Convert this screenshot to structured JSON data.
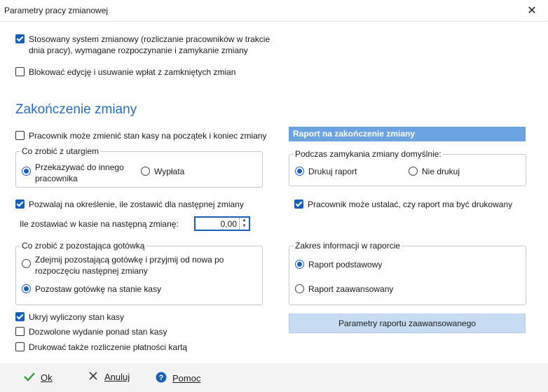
{
  "window": {
    "title": "Parametry pracy zmianowej"
  },
  "top": {
    "shift_system": {
      "label_line1": "Stosowany system zmianowy (rozliczanie pracowników w trakcie",
      "label_line2": "dnia pracy), wymagane rozpoczynanie i zamykanie zmiany",
      "checked": true
    },
    "block_edit": {
      "label": "Blokować edycję i usuwanie wpłat z zamkniętych zmian",
      "checked": false
    }
  },
  "end_shift": {
    "heading": "Zakończenie zmiany",
    "change_cash": {
      "label": "Pracownik może zmienić stan kasy na początek i koniec zmiany",
      "checked": false
    },
    "revenue_group": {
      "title": "Co zrobić z utargiem",
      "options": [
        {
          "label_line1": "Przekazywać do innego",
          "label_line2": "pracownika",
          "selected": true
        },
        {
          "label": "Wypłata",
          "selected": false
        }
      ]
    },
    "allow_leave": {
      "label": "Pozwalaj na określenie, ile zostawić dla następnej zmiany",
      "checked": true
    },
    "leave_amount": {
      "label": "Ile zostawiać w kasie na następną zmianę:",
      "value": "0,00"
    },
    "remaining_group": {
      "title": "Co zrobić z pozostająca gotówką",
      "options": [
        {
          "label_line1": "Zdejmij pozostającą gotówkę i przyjmij od nowa po",
          "label_line2": "rozpoczęciu następnej zmiany",
          "selected": false
        },
        {
          "label": "Pozostaw gotówkę na stanie kasy",
          "selected": true
        }
      ]
    },
    "hide_cash": {
      "label": "Ukryj wyliczony stan kasy",
      "checked": true
    },
    "allow_over": {
      "label": "Dozwolone wydanie ponad stan kasy",
      "checked": false
    },
    "print_card": {
      "label": "Drukować także rozliczenie płatności kartą",
      "checked": false
    }
  },
  "report": {
    "heading": "Raport na zakończenie zmiany",
    "default_group": {
      "title": "Podczas zamykania zmiany domyślnie:",
      "options": [
        {
          "label": "Drukuj raport",
          "selected": true
        },
        {
          "label": "Nie drukuj",
          "selected": false
        }
      ]
    },
    "employee_decides": {
      "label": "Pracownik może ustalać, czy raport ma być drukowany",
      "checked": true
    },
    "scope_group": {
      "title": "Zakres informacji w raporcie",
      "options": [
        {
          "label": "Raport podstawowy",
          "selected": true
        },
        {
          "label": "Raport zaawansowany",
          "selected": false
        }
      ]
    },
    "advanced_button": "Parametry raportu zaawansowanego"
  },
  "footer": {
    "ok": "Ok",
    "cancel": "Anuluj",
    "help": "Pomoc"
  },
  "colors": {
    "accent": "#1b5fb5",
    "heading": "#2a6ebb",
    "section_bar": "#6ba3e0",
    "wide_button": "#c7dcf2"
  }
}
